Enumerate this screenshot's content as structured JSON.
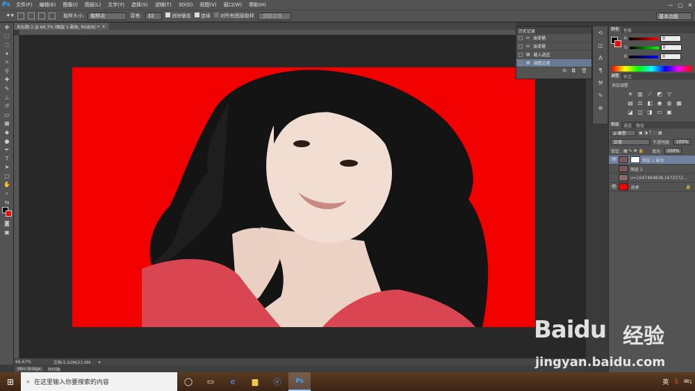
{
  "menubar": {
    "logo": "Ps",
    "items": [
      "文件(F)",
      "编辑(E)",
      "图像(I)",
      "图层(L)",
      "文字(Y)",
      "选择(S)",
      "滤镜(T)",
      "3D(D)",
      "视图(V)",
      "窗口(W)",
      "帮助(H)"
    ],
    "win_controls": [
      "—",
      "□",
      "✕"
    ]
  },
  "optbar": {
    "sample_size_label": "取样大小:",
    "sample_size_value": "取样点",
    "tolerance_label": "容差:",
    "tolerance_value": "32",
    "antialias_label": "消除锯齿",
    "contiguous_label": "连续",
    "sample_all_label": "对所有图层取样",
    "refine_edge_label": "调整边缘...",
    "workspace": "基本功能"
  },
  "document": {
    "tab_title": "未标题-1 @ 66.7% (图层 1 副本, RGB/8) *",
    "zoom": "66.67%",
    "doc_size": "文档:5.93M/21.0M"
  },
  "minibridge": {
    "tabs": [
      "Mini Bridge",
      "时间轴"
    ]
  },
  "history": {
    "title": "历史记录",
    "items": [
      {
        "label": "油漆桶",
        "selected": false
      },
      {
        "label": "油漆桶",
        "selected": false
      },
      {
        "label": "载入选区",
        "selected": false
      },
      {
        "label": "调整边缘",
        "selected": true
      }
    ]
  },
  "color_panel": {
    "tabs": [
      "颜色",
      "色板"
    ],
    "foreground": "#000000",
    "background": "#ff0000",
    "r_label": "R",
    "r_value": "0",
    "g_label": "G",
    "g_value": "0",
    "b_label": "B",
    "b_value": "0"
  },
  "adjustments_panel": {
    "tabs": [
      "调整",
      "样式"
    ],
    "add_label": "添加调整"
  },
  "layers_panel": {
    "tabs": [
      "图层",
      "通道",
      "路径"
    ],
    "kind_label": "ρ 类型",
    "blend_mode": "正常",
    "opacity_label": "不透明度:",
    "opacity_value": "100%",
    "lock_label": "锁定:",
    "fill_label": "填充:",
    "fill_value": "100%",
    "layers": [
      {
        "name": "图层 1 副本",
        "visible": true,
        "selected": true
      },
      {
        "name": "图层 1",
        "visible": false,
        "selected": false
      },
      {
        "name": "u=1047494838,1672372...",
        "visible": false,
        "selected": false
      },
      {
        "name": "背景",
        "visible": true,
        "selected": false
      }
    ]
  },
  "taskbar": {
    "search_placeholder": "在这里输入你要搜索的内容",
    "ime": "英",
    "notification_count": "1"
  },
  "watermark": {
    "logo": "Baidu",
    "cn": "经验",
    "url": "jingyan.baidu.com"
  },
  "colors": {
    "canvas_fill": "#f20000",
    "hair": "#141414",
    "skin": "#f1ddd2",
    "sweater": "#d94550",
    "selected_row": "#687a94"
  }
}
